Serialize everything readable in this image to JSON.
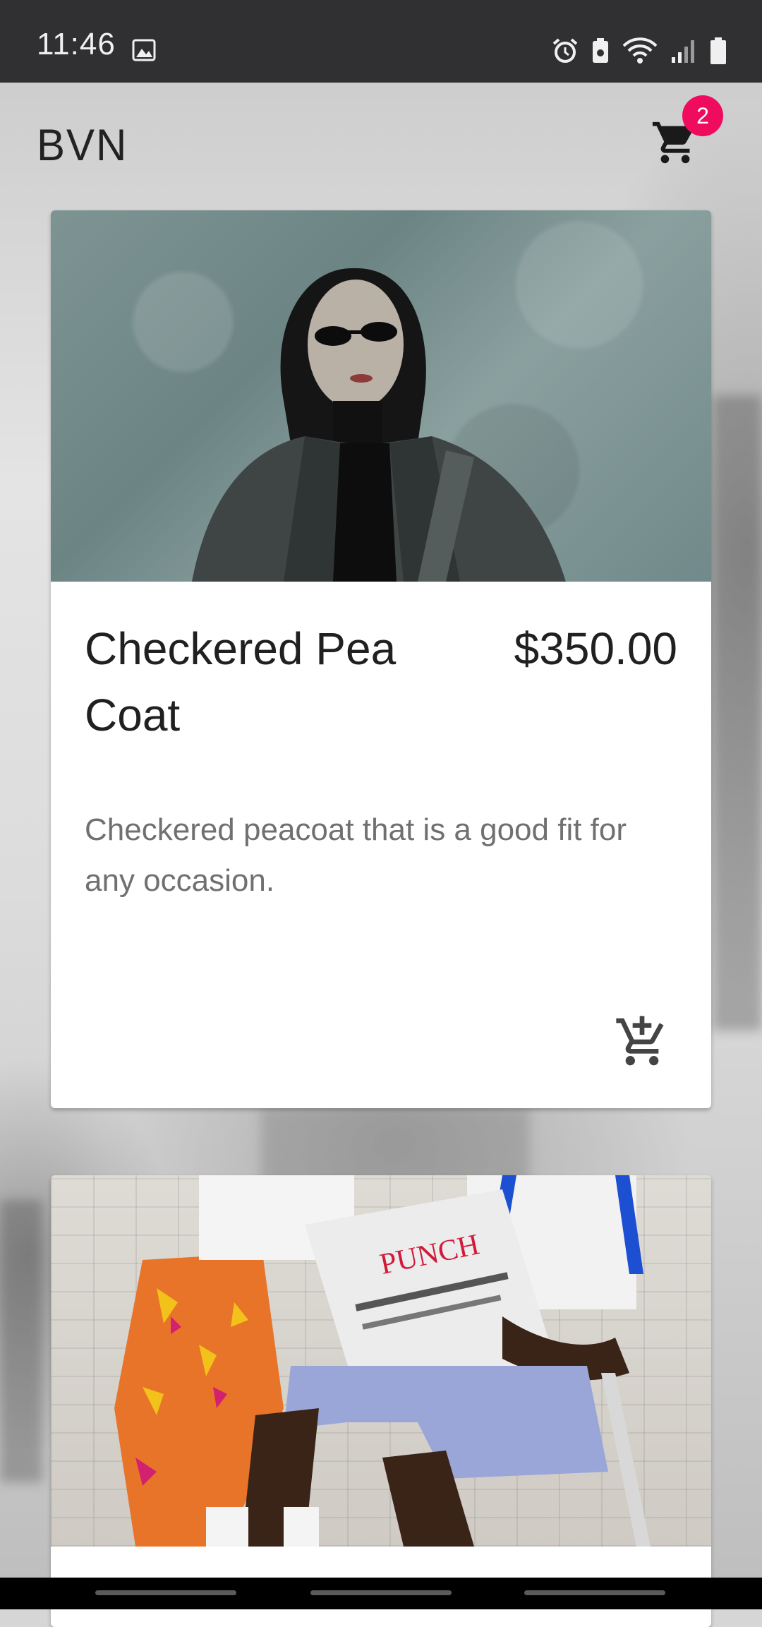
{
  "status_bar": {
    "time": "11:46",
    "icons": [
      "photo-icon",
      "alarm-icon",
      "battery-saver-icon",
      "wifi-icon",
      "signal-icon",
      "battery-icon"
    ]
  },
  "app_bar": {
    "brand": "BVN",
    "cart_count": "2",
    "badge_color": "#ef0b5d"
  },
  "products": [
    {
      "title": "Checkered Pea Coat",
      "price": "$350.00",
      "description": "Checkered peacoat that is a good fit for any occasion.",
      "image": "product-photo-pea-coat"
    },
    {
      "image": "product-photo-newspaper"
    }
  ],
  "colors": {
    "status_bar_bg": "#303033",
    "card_bg": "#ffffff",
    "title_text": "#202020",
    "description_text": "#707070"
  }
}
